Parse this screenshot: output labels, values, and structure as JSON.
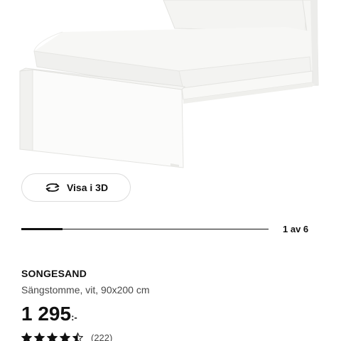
{
  "product_image": {
    "alt": "SONGESAND bed frame, white"
  },
  "view_3d": {
    "label": "Visa i 3D",
    "icon": "rotate-3d-icon"
  },
  "carousel": {
    "current": 1,
    "total": 6,
    "counter_text": "1 av 6",
    "progress_fraction": 0.166
  },
  "product": {
    "name": "SONGESAND",
    "description": "Sängstomme, vit, 90x200 cm",
    "price_amount": "1 295",
    "price_suffix": ":-"
  },
  "rating": {
    "stars": 4.5,
    "max_stars": 5,
    "review_count_text": "(222)",
    "star_icon": "star-icon",
    "star_color": "#111111"
  },
  "colors": {
    "text": "#111111",
    "secondary_text": "#484848",
    "button_border": "#dcdcdc",
    "background": "#ffffff"
  }
}
